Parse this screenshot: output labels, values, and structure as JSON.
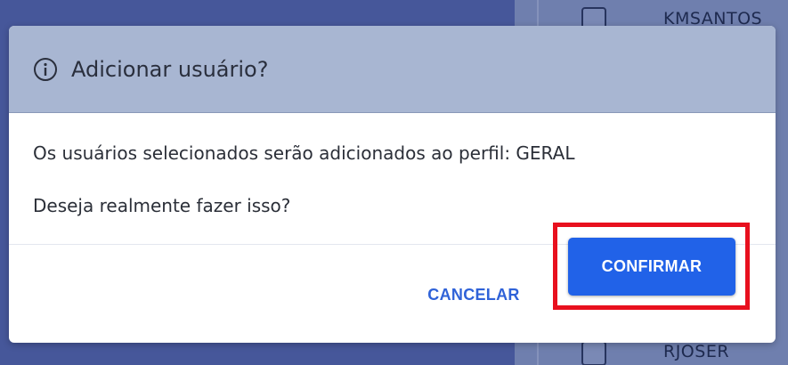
{
  "background": {
    "users": [
      "KMSANTOS",
      "RJOSER"
    ]
  },
  "dialog": {
    "title": "Adicionar usuário?",
    "icon": "info-icon",
    "message_line_1": "Os usuários selecionados serão adicionados ao perfil: GERAL",
    "message_line_2": "Deseja realmente fazer isso?",
    "cancel_label": "CANCELAR",
    "confirm_label": "CONFIRMAR"
  },
  "colors": {
    "header_bg": "#a8b6d2",
    "primary": "#2162e8",
    "link": "#2f62d8",
    "highlight": "#e8101e"
  }
}
